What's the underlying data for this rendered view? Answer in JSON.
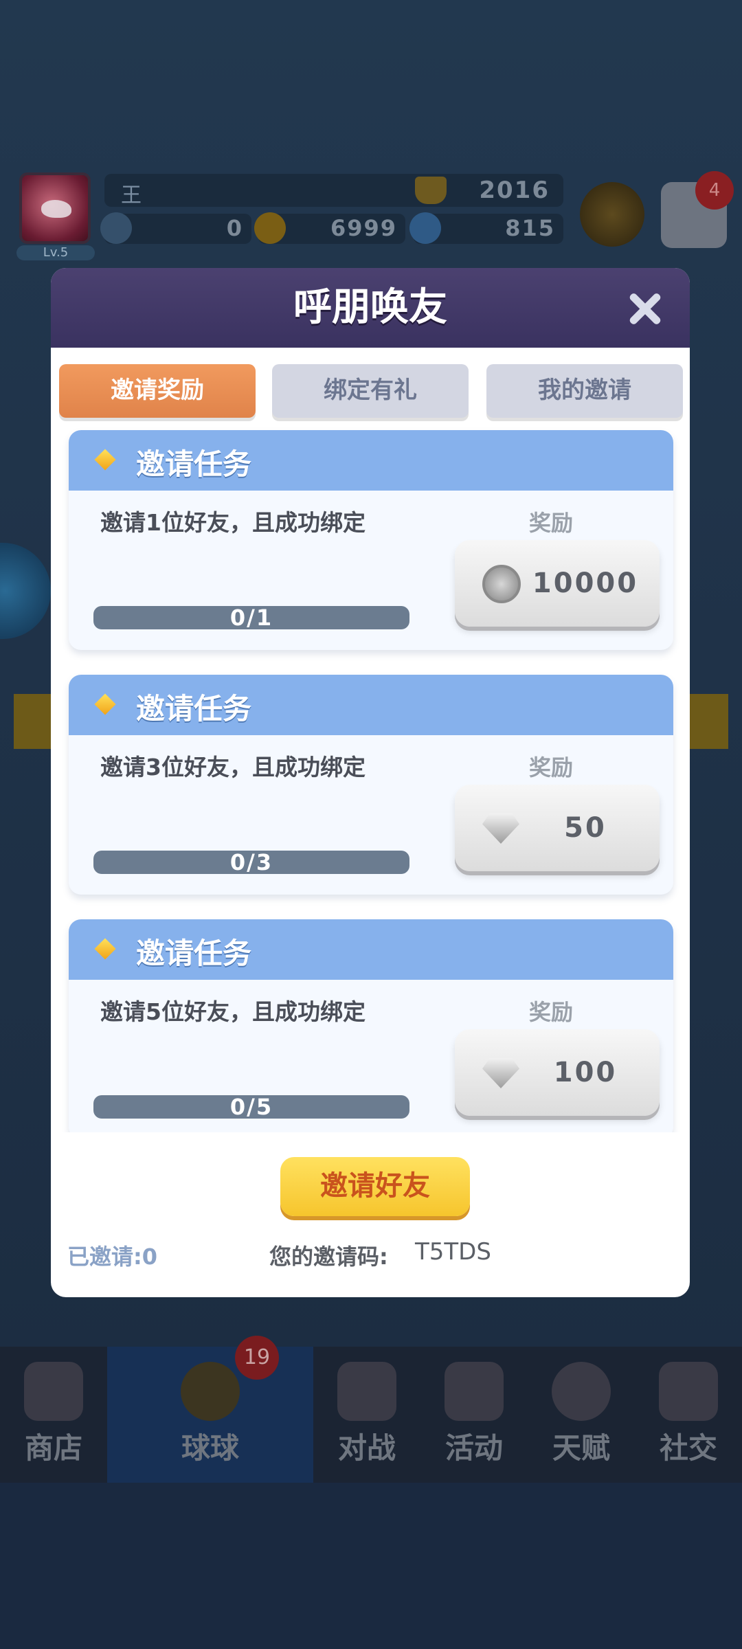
{
  "hud": {
    "player_level": "Lv.5",
    "player_name": "王",
    "trophy_score": "2016",
    "resources": [
      {
        "icon": "energy-icon",
        "value": "0"
      },
      {
        "icon": "gold-coin-icon",
        "value": "6999"
      },
      {
        "icon": "diamond-icon",
        "value": "815"
      }
    ],
    "mail_badge": "4"
  },
  "modal": {
    "title": "呼朋唤友",
    "tabs": [
      {
        "label": "邀请奖励",
        "active": true
      },
      {
        "label": "绑定有礼",
        "active": false
      },
      {
        "label": "我的邀请",
        "active": false
      }
    ],
    "tasks": [
      {
        "title": "邀请任务",
        "desc": "邀请1位好友，且成功绑定",
        "reward_label": "奖励",
        "reward_icon": "silver-coin-icon",
        "reward_value": "10000",
        "progress_text": "0/1",
        "progress": 0
      },
      {
        "title": "邀请任务",
        "desc": "邀请3位好友，且成功绑定",
        "reward_label": "奖励",
        "reward_icon": "silver-diamond-icon",
        "reward_value": "50",
        "progress_text": "0/3",
        "progress": 0
      },
      {
        "title": "邀请任务",
        "desc": "邀请5位好友，且成功绑定",
        "reward_label": "奖励",
        "reward_icon": "silver-diamond-icon",
        "reward_value": "100",
        "progress_text": "0/5",
        "progress": 0
      }
    ],
    "invite_button": "邀请好友",
    "invited_count": "已邀请:0",
    "invite_code_label": "您的邀请码:",
    "invite_code": "T5TDS"
  },
  "bottom_nav": {
    "items": [
      "商店",
      "球球",
      "对战",
      "活动",
      "天赋",
      "社交"
    ],
    "active": "球球",
    "badge": "19"
  },
  "colors": {
    "active_tab": "#e8884f",
    "task_header": "#86b1ec",
    "invite_button": "#f9d03c"
  }
}
